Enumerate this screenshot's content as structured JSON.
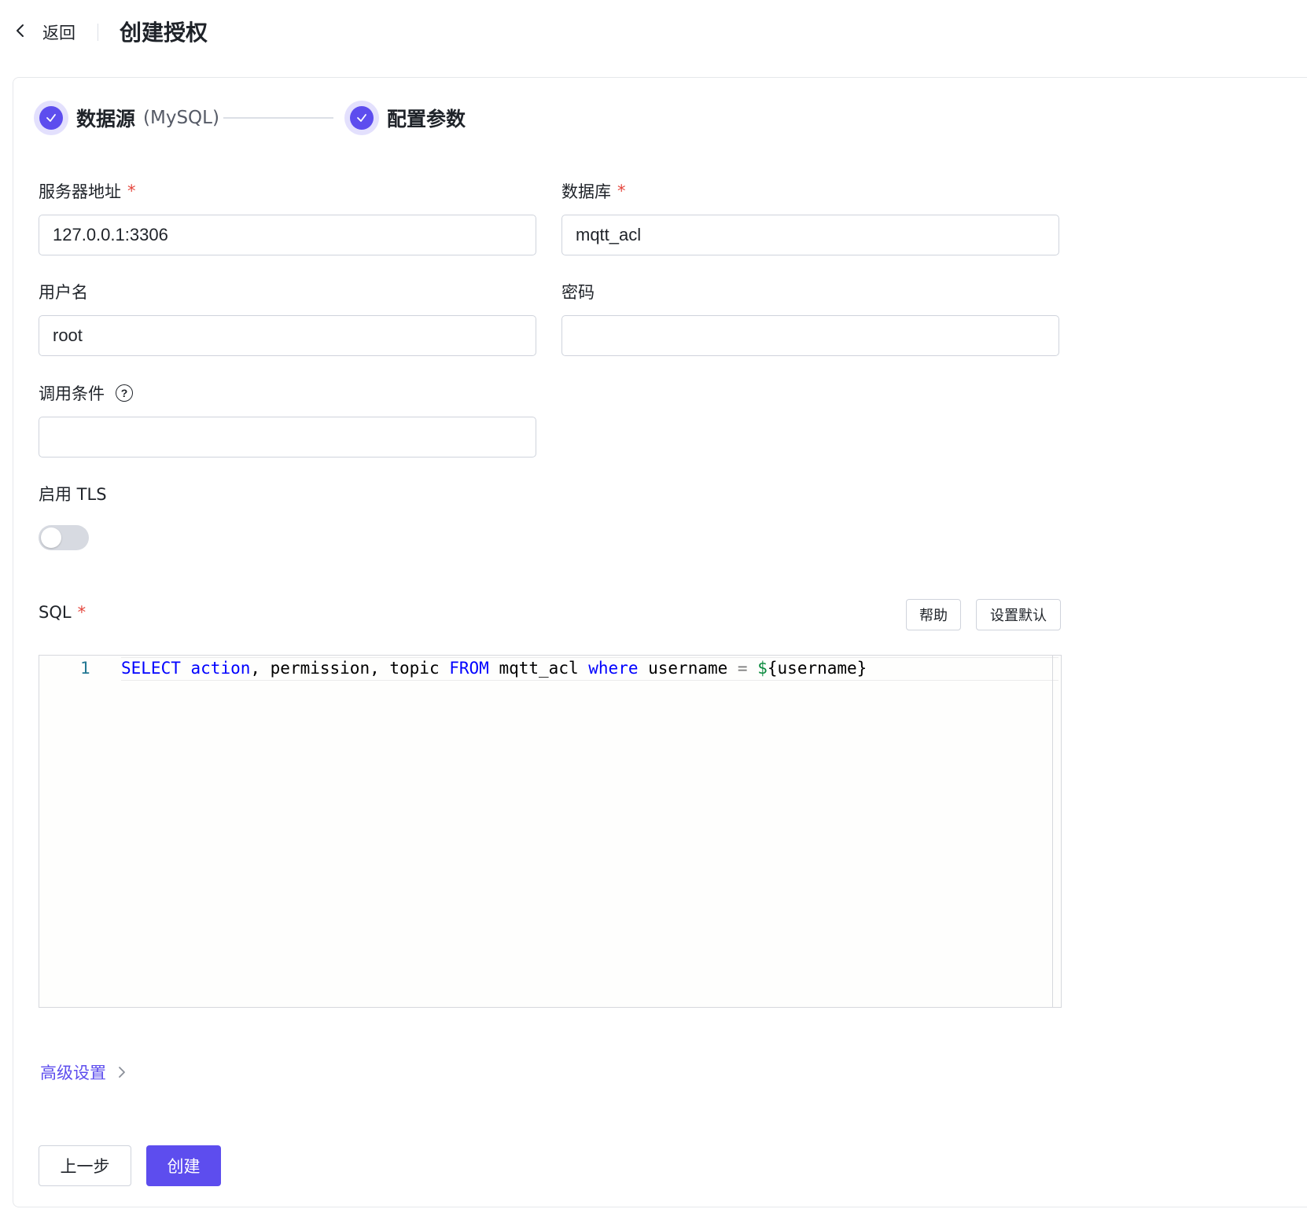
{
  "header": {
    "back_label": "返回",
    "title": "创建授权"
  },
  "steps": [
    {
      "title": "数据源",
      "subtitle": "(MySQL)",
      "status": "done"
    },
    {
      "title": "配置参数",
      "subtitle": "",
      "status": "done"
    }
  ],
  "form": {
    "server": {
      "label": "服务器地址",
      "value": "127.0.0.1:3306",
      "required": true
    },
    "database": {
      "label": "数据库",
      "value": "mqtt_acl",
      "required": true
    },
    "username": {
      "label": "用户名",
      "value": "root"
    },
    "password": {
      "label": "密码",
      "value": ""
    },
    "condition": {
      "label": "调用条件",
      "value": ""
    },
    "tls": {
      "label": "启用 TLS",
      "enabled": false
    },
    "sql": {
      "label": "SQL",
      "required": true,
      "help_button": "帮助",
      "default_button": "设置默认",
      "line_numbers": [
        "1"
      ],
      "code": {
        "select": "SELECT",
        "action": "action",
        "mid1": ", permission, topic ",
        "from": "FROM",
        "mid2": " mqtt_acl ",
        "where": "where",
        "mid3": " username ",
        "eq": "=",
        "sp": " ",
        "dollar": "$",
        "tail": "{username}"
      }
    }
  },
  "advanced_label": "高级设置",
  "footer": {
    "prev_label": "上一步",
    "create_label": "创建"
  },
  "colors": {
    "primary": "#5d4dee",
    "required": "#e5483f",
    "keyword": "#0000ff"
  },
  "icons": [
    "chevron-left-icon",
    "check-icon",
    "question-circle-icon",
    "chevron-right-icon"
  ]
}
